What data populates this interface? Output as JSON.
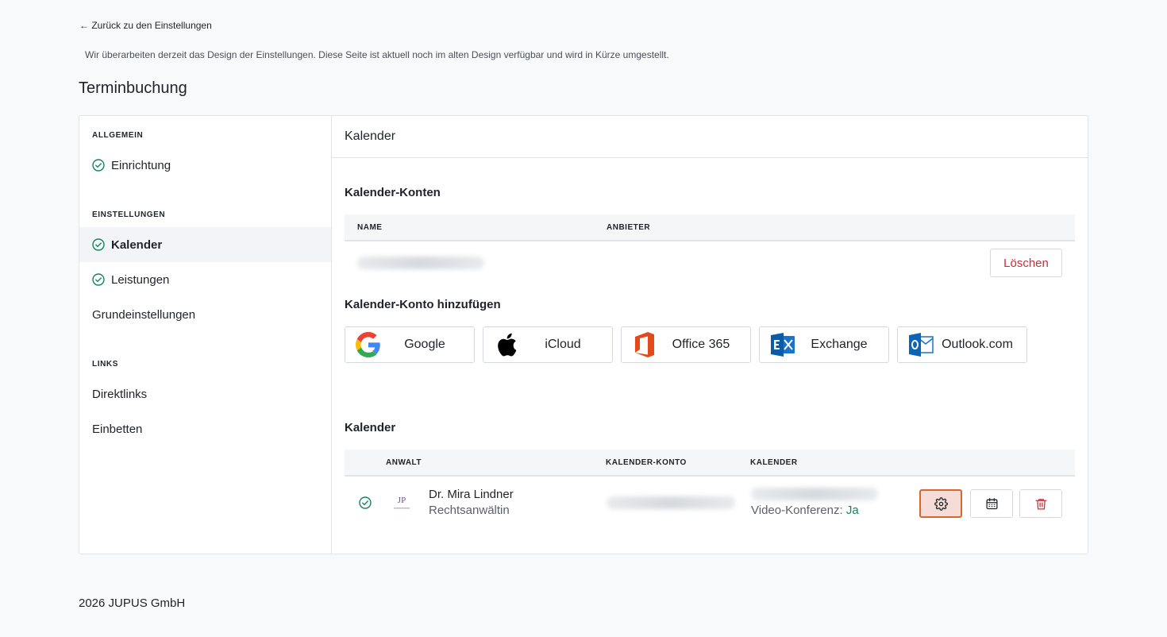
{
  "nav": {
    "back_label": "← Zurück zu den Einstellungen"
  },
  "notice": "Wir überarbeiten derzeit das Design der Einstellungen. Diese Seite ist aktuell noch im alten Design verfügbar und wird in Kürze umgestellt.",
  "page_title": "Terminbuchung",
  "sidebar": {
    "sections": [
      {
        "label": "ALLGEMEIN"
      },
      {
        "label": "EINSTELLUNGEN"
      },
      {
        "label": "LINKS"
      }
    ],
    "items": [
      {
        "label": "Einrichtung",
        "checked": true,
        "active": false
      },
      {
        "label": "Kalender",
        "checked": true,
        "active": true
      },
      {
        "label": "Leistungen",
        "checked": true,
        "active": false
      },
      {
        "label": "Grundeinstellungen",
        "checked": false,
        "active": false
      },
      {
        "label": "Direktlinks",
        "checked": false,
        "active": false
      },
      {
        "label": "Einbetten",
        "checked": false,
        "active": false
      }
    ]
  },
  "main": {
    "header": "Kalender",
    "accounts": {
      "title": "Kalender-Konten",
      "columns": [
        "NAME",
        "ANBIETER"
      ],
      "delete_label": "Löschen"
    },
    "add_account": {
      "title": "Kalender-Konto hinzufügen",
      "providers": [
        {
          "label": "Google",
          "icon": "google-icon"
        },
        {
          "label": "iCloud",
          "icon": "apple-icon"
        },
        {
          "label": "Office 365",
          "icon": "office365-icon"
        },
        {
          "label": "Exchange",
          "icon": "exchange-icon"
        },
        {
          "label": "Outlook.com",
          "icon": "outlook-icon"
        }
      ]
    },
    "calendars": {
      "title": "Kalender",
      "columns": [
        "ANWALT",
        "KALENDER-KONTO",
        "KALENDER"
      ],
      "row": {
        "name": "Dr. Mira Lindner",
        "role": "Rechtsanwältin",
        "video_label": "Video-Konferenz:",
        "video_value": "Ja"
      }
    },
    "colors": {
      "accent_green": "#16855d",
      "danger_red": "#c62f3a",
      "selected_orange": "#d9652f"
    }
  },
  "footer": "2026 JUPUS GmbH"
}
